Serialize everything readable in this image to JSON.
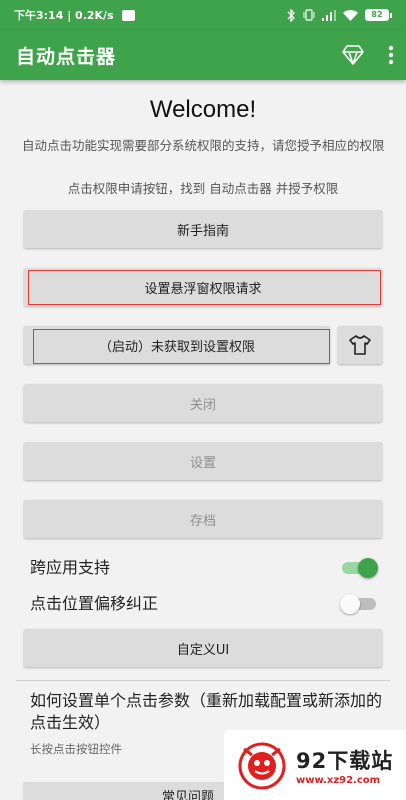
{
  "status_bar": {
    "time_speed": "下午3:14 | 0.2K/s",
    "battery": "82"
  },
  "app_bar": {
    "title": "自动点击器",
    "gem_icon": "diamond-outline-icon",
    "menu_icon": "more-vert-icon"
  },
  "main": {
    "welcome": "Welcome!",
    "description": "自动点击功能实现需要部分系统权限的支持，请您授予相应的权限",
    "hint": "点击权限申请按钮，找到 自动点击器 并授予权限",
    "buttons": {
      "guide": "新手指南",
      "overlay_permission": "设置悬浮窗权限请求",
      "start": "（启动）未获取到设置权限",
      "close": "关闭",
      "settings": "设置",
      "archive": "存档",
      "custom_ui": "自定义UI"
    },
    "shirt_icon": "tshirt-icon",
    "switches": {
      "cross_app": {
        "label": "跨应用支持",
        "on": true
      },
      "offset_fix": {
        "label": "点击位置偏移纠正",
        "on": false
      }
    },
    "section": {
      "title": "如何设置单个点击参数（重新加载配置或新添加的点击生效）",
      "subtitle": "长按点击按钮控件"
    },
    "bottom_button_partial": "常见问题"
  },
  "watermark": {
    "title": "92下载站",
    "url": "www.xz92.com"
  },
  "colors": {
    "primary": "#3ea34a",
    "highlight_box": "#e53935"
  }
}
